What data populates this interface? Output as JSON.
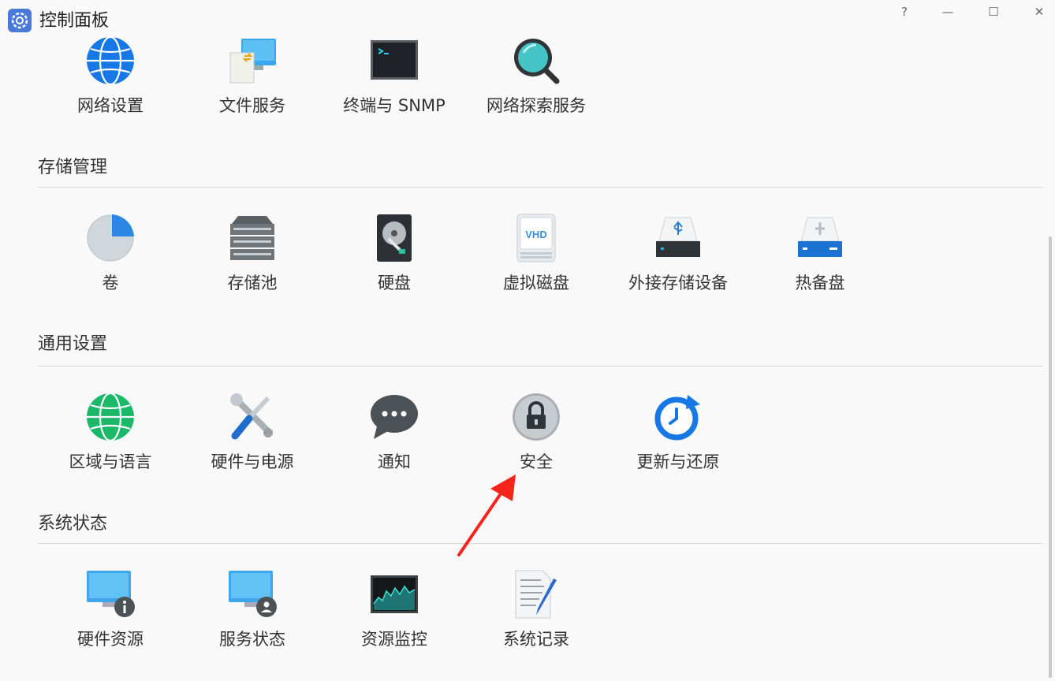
{
  "window": {
    "title": "控制面板",
    "help_label": "?",
    "minimize_label": "—",
    "maximize_label": "☐",
    "close_label": "✕"
  },
  "sections": {
    "network": {
      "items": [
        {
          "label": "网络设置",
          "icon": "globe-icon"
        },
        {
          "label": "文件服务",
          "icon": "file-service-icon"
        },
        {
          "label": "终端与 SNMP",
          "icon": "terminal-icon"
        },
        {
          "label": "网络探索服务",
          "icon": "magnifier-icon"
        }
      ]
    },
    "storage": {
      "title": "存储管理",
      "items": [
        {
          "label": "卷",
          "icon": "pie-volume-icon"
        },
        {
          "label": "存储池",
          "icon": "storage-pool-icon"
        },
        {
          "label": "硬盘",
          "icon": "hard-disk-icon"
        },
        {
          "label": "虚拟磁盘",
          "icon": "vhd-icon",
          "icon_text": "VHD"
        },
        {
          "label": "外接存储设备",
          "icon": "usb-storage-icon"
        },
        {
          "label": "热备盘",
          "icon": "hot-spare-icon"
        }
      ]
    },
    "general": {
      "title": "通用设置",
      "items": [
        {
          "label": "区域与语言",
          "icon": "region-globe-icon"
        },
        {
          "label": "硬件与电源",
          "icon": "tools-icon"
        },
        {
          "label": "通知",
          "icon": "chat-bubble-icon"
        },
        {
          "label": "安全",
          "icon": "lock-icon"
        },
        {
          "label": "更新与还原",
          "icon": "update-clock-icon"
        }
      ]
    },
    "status": {
      "title": "系统状态",
      "items": [
        {
          "label": "硬件资源",
          "icon": "monitor-info-icon"
        },
        {
          "label": "服务状态",
          "icon": "monitor-user-icon"
        },
        {
          "label": "资源监控",
          "icon": "resource-graph-icon"
        },
        {
          "label": "系统记录",
          "icon": "log-pen-icon"
        }
      ]
    }
  },
  "colors": {
    "accent_blue": "#1e88e5",
    "annotation_arrow": "#f5251b"
  }
}
